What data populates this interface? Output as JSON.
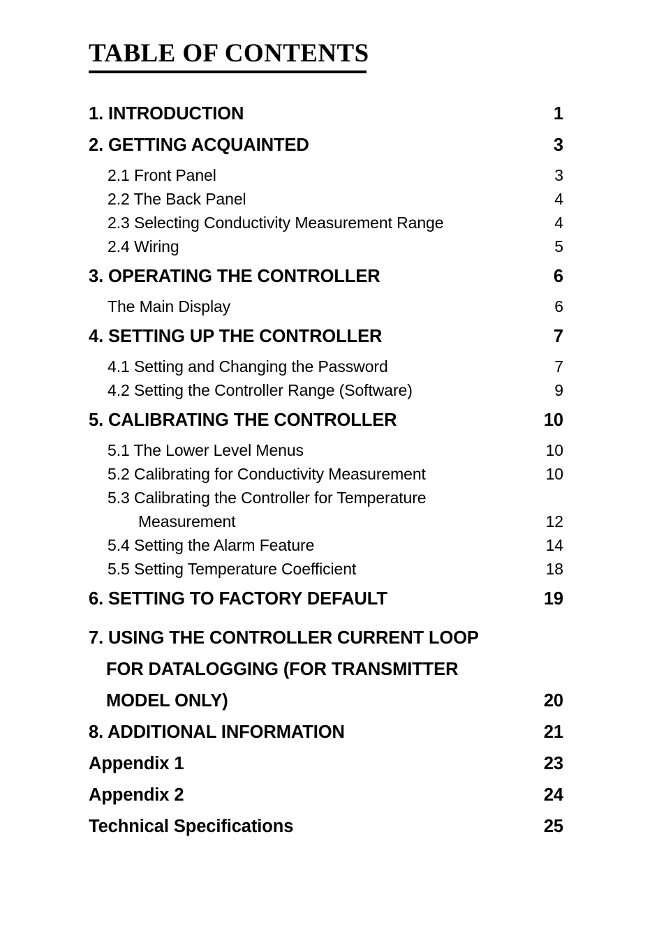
{
  "document": {
    "title": "TABLE OF CONTENTS"
  },
  "toc": {
    "entries": [
      {
        "id": "introduction",
        "level": 1,
        "lines": [
          "1. INTRODUCTION"
        ],
        "page": "1"
      },
      {
        "id": "getting-acquainted",
        "level": 1,
        "lines": [
          "2. GETTING ACQUAINTED"
        ],
        "page": "3"
      },
      {
        "id": "front-panel",
        "level": 2,
        "lines": [
          "2.1 Front Panel"
        ],
        "page": "3"
      },
      {
        "id": "the-back-panel",
        "level": 2,
        "lines": [
          "2.2 The Back Panel"
        ],
        "page": "4"
      },
      {
        "id": "selecting-conductivity-measurement-range",
        "level": 2,
        "lines": [
          "2.3 Selecting Conductivity Measurement Range"
        ],
        "page": "4"
      },
      {
        "id": "wiring",
        "level": 2,
        "lines": [
          "2.4 Wiring"
        ],
        "page": "5"
      },
      {
        "id": "operating-the-controller",
        "level": 1,
        "lines": [
          "3. OPERATING THE CONTROLLER"
        ],
        "page": "6"
      },
      {
        "id": "the-main-display",
        "level": 2,
        "lines": [
          "The Main Display"
        ],
        "page": "6"
      },
      {
        "id": "setting-up-the-controller",
        "level": 1,
        "lines": [
          "4. SETTING UP THE CONTROLLER"
        ],
        "page": "7"
      },
      {
        "id": "setting-and-changing-the-password",
        "level": 2,
        "lines": [
          "4.1 Setting and Changing the Password"
        ],
        "page": "7"
      },
      {
        "id": "setting-the-controller-range-software",
        "level": 2,
        "lines": [
          "4.2 Setting the Controller Range (Software)"
        ],
        "page": "9"
      },
      {
        "id": "calibrating-the-controller",
        "level": 1,
        "lines": [
          "5. CALIBRATING THE CONTROLLER"
        ],
        "page": "10"
      },
      {
        "id": "the-lower-level-menus",
        "level": 2,
        "lines": [
          "5.1 The Lower Level Menus"
        ],
        "page": "10"
      },
      {
        "id": "calibrating-for-conductivity-measurement",
        "level": 2,
        "lines": [
          "5.2 Calibrating for Conductivity Measurement"
        ],
        "page": "10"
      },
      {
        "id": "calibrating-the-controller-for-temperature-measurement",
        "level": 2,
        "lines": [
          "5.3 Calibrating the Controller for Temperature",
          "Measurement"
        ],
        "page": "12"
      },
      {
        "id": "setting-the-alarm-feature",
        "level": 2,
        "lines": [
          "5.4 Setting the Alarm Feature"
        ],
        "page": "14"
      },
      {
        "id": "setting-temperature-coefficient",
        "level": 2,
        "lines": [
          "5.5 Setting Temperature Coefficient"
        ],
        "page": "18"
      },
      {
        "id": "setting-to-factory-default",
        "level": 1,
        "lines": [
          "6. SETTING TO FACTORY DEFAULT"
        ],
        "page": "19"
      },
      {
        "id": "using-the-controller-current-loop-for-datalogging",
        "level": 1,
        "lines": [
          "7. USING THE CONTROLLER CURRENT LOOP",
          "FOR DATALOGGING (FOR TRANSMITTER",
          "MODEL ONLY)"
        ],
        "page": "20"
      },
      {
        "id": "additional-information",
        "level": 1,
        "lines": [
          "8. ADDITIONAL INFORMATION"
        ],
        "page": "21"
      },
      {
        "id": "appendix-1",
        "level": 1,
        "lines": [
          "Appendix 1"
        ],
        "page": "23"
      },
      {
        "id": "appendix-2",
        "level": 1,
        "lines": [
          "Appendix 2"
        ],
        "page": "24"
      },
      {
        "id": "technical-specifications",
        "level": 1,
        "lines": [
          "Technical Specifications"
        ],
        "page": "25"
      }
    ]
  }
}
